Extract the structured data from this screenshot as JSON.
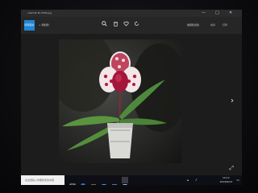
{
  "window": {
    "title": "sdam4k Br.3936.jpg",
    "controls": [
      "—",
      "□",
      "✕"
    ]
  },
  "toolbar": {
    "all_photos_label": "所有照片",
    "add_label": "+ 添加到",
    "icons": [
      "zoom-icon",
      "delete-icon",
      "favorite-icon",
      "rotate-icon"
    ],
    "edit_label": "编辑和创建",
    "share_label": "共享",
    "print_label": "打印"
  },
  "viewer": {
    "next_arrow": "›",
    "expand_icon": "⤢"
  },
  "taskbar": {
    "search_placeholder": "在这里输入你要搜索的内容",
    "clock_time": "10:12",
    "clock_date": "2019/6/24"
  }
}
